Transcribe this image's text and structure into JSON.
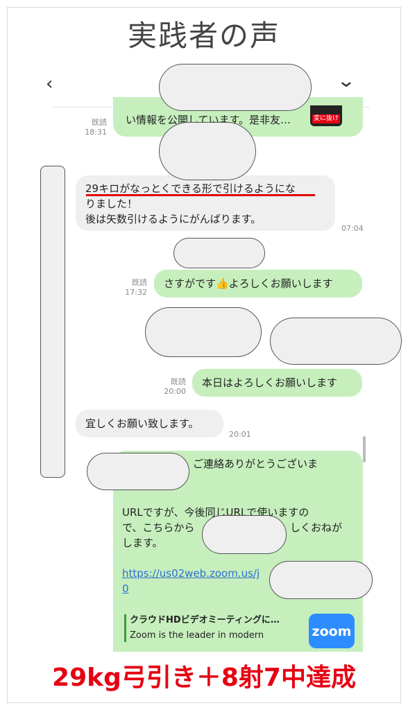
{
  "page": {
    "title": "実践者の声"
  },
  "nav": {
    "back_glyph": "‹",
    "menu_glyph": "⌄"
  },
  "messages": {
    "m1": {
      "text": "い情報を公開しています。是非友…",
      "read": "既読",
      "time": "18:31",
      "thumb_tag": "変に抜け"
    },
    "m2": {
      "line1": "29キロがなっとくできる形で引けるようにな",
      "line2": "りました！",
      "line3": "後は矢数引けるようにがんばります。",
      "time": "07:04"
    },
    "m3": {
      "text": "さすがです👍よろしくお願いします",
      "read": "既読",
      "time": "17:32"
    },
    "m4": {
      "text": "本日はよろしくお願いします",
      "read": "既読",
      "time": "20:00"
    },
    "m5": {
      "text": "宜しくお願い致します。",
      "time": "20:01"
    },
    "m6": {
      "line1": "ご連絡ありがとうございま",
      "line2": "URLですが、今後同じURLで使いますの",
      "line3a": "で、こちらから",
      "line3b": "しくおねが",
      "line4": "します。",
      "link1": "https://us02web.zoom.us/j",
      "link2": "0",
      "preview_title": "クラウドHDビデオミーティングに…",
      "preview_desc": "Zoom is the leader in modern",
      "preview_logo": "zoom"
    }
  },
  "banner": {
    "text": "29kg弓引き＋8射7中達成"
  }
}
